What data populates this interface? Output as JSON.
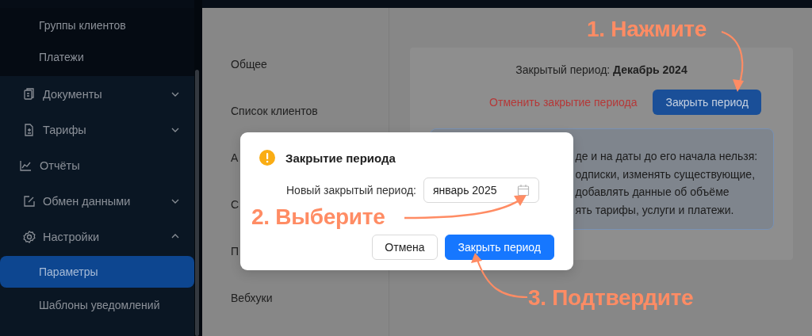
{
  "sidebar": {
    "open_submenu": {
      "items": [
        {
          "label": "Группы клиентов"
        },
        {
          "label": "Платежи"
        }
      ]
    },
    "items": [
      {
        "label": "Документы",
        "kind": "group",
        "expanded": false
      },
      {
        "label": "Тарифы",
        "kind": "group",
        "expanded": false
      },
      {
        "label": "Отчёты",
        "kind": "link"
      },
      {
        "label": "Обмен данными",
        "kind": "group",
        "expanded": false
      },
      {
        "label": "Настройки",
        "kind": "group",
        "expanded": true,
        "children": [
          {
            "label": "Параметры",
            "selected": true
          },
          {
            "label": "Шаблоны уведомлений",
            "selected": false
          }
        ]
      }
    ]
  },
  "settings_nav": [
    {
      "label": "Общее"
    },
    {
      "label": "Список клиентов"
    },
    {
      "label": "А"
    },
    {
      "label": "С"
    },
    {
      "label": "П"
    },
    {
      "label": "Вебхуки"
    }
  ],
  "period_card": {
    "label": "Закрытый период:",
    "value": "Декабрь 2024",
    "cancel_link": "Отменить закрытие периода",
    "close_button": "Закрыть период",
    "notice_lines": [
      "де и на даты до его начала нельзя:",
      "одписки, изменять существующие,",
      "добавлять данные об объёме",
      "ять тарифы, услуги и платежи."
    ]
  },
  "dialog": {
    "title": "Закрытие периода",
    "field_label": "Новый закрытый период:",
    "field_value": "январь 2025",
    "buttons": [
      {
        "label": "Отмена",
        "kind": "default"
      },
      {
        "label": "Закрыть период",
        "kind": "primary"
      }
    ]
  },
  "annotations": [
    {
      "text": "1. Нажмите"
    },
    {
      "text": "2. Выберите"
    },
    {
      "text": "3. Подтвердите"
    }
  ]
}
